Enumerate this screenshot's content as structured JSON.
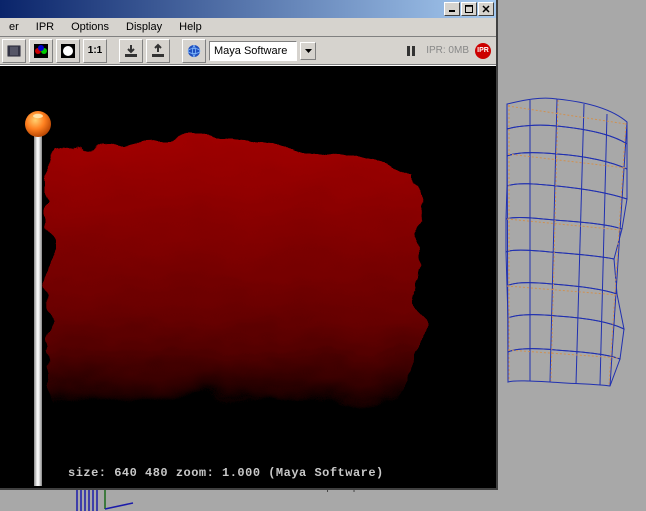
{
  "menubar": {
    "items": [
      "er",
      "IPR",
      "Options",
      "Display",
      "Help"
    ]
  },
  "toolbar": {
    "one_to_one": "1:1",
    "renderer_selected": "Maya Software",
    "ipr_label": "IPR: 0MB",
    "ipr_badge": "IPR"
  },
  "render": {
    "status_line": "size:  640  480 zoom: 1.000  (Maya Software)"
  },
  "background_viewport": {
    "camera": "persp"
  },
  "title_buttons": {
    "minimize": "_",
    "maximize": "□",
    "close": "×"
  }
}
